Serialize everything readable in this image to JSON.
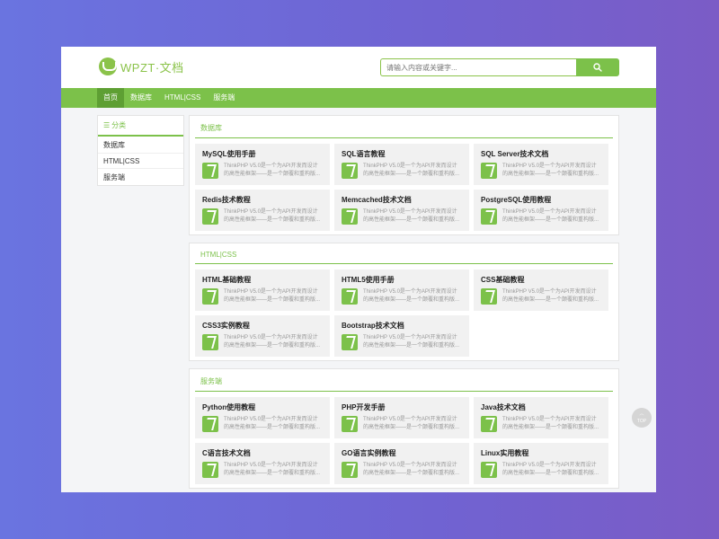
{
  "header": {
    "logo_text": "WPZT·文档",
    "search_placeholder": "请输入内容或关键字..."
  },
  "nav": {
    "items": [
      "首页",
      "数据库",
      "HTML|CSS",
      "服务端"
    ]
  },
  "sidebar": {
    "title": "分类",
    "items": [
      "数据库",
      "HTML|CSS",
      "服务端"
    ]
  },
  "sections": [
    {
      "title": "数据库",
      "cards": [
        {
          "title": "MySQL使用手册",
          "desc": "ThinkPHP V5.0是一个为API开发而设计的高性能框架——是一个颠覆和重构版..."
        },
        {
          "title": "SQL语言教程",
          "desc": "ThinkPHP V5.0是一个为API开发而设计的高性能框架——是一个颠覆和重构版..."
        },
        {
          "title": "SQL Server技术文档",
          "desc": "ThinkPHP V5.0是一个为API开发而设计的高性能框架——是一个颠覆和重构版..."
        },
        {
          "title": "Redis技术教程",
          "desc": "ThinkPHP V5.0是一个为API开发而设计的高性能框架——是一个颠覆和重构版..."
        },
        {
          "title": "Memcached技术文档",
          "desc": "ThinkPHP V5.0是一个为API开发而设计的高性能框架——是一个颠覆和重构版..."
        },
        {
          "title": "PostgreSQL使用教程",
          "desc": "ThinkPHP V5.0是一个为API开发而设计的高性能框架——是一个颠覆和重构版..."
        }
      ]
    },
    {
      "title": "HTML|CSS",
      "cards": [
        {
          "title": "HTML基础教程",
          "desc": "ThinkPHP V5.0是一个为API开发而设计的高性能框架——是一个颠覆和重构版..."
        },
        {
          "title": "HTML5使用手册",
          "desc": "ThinkPHP V5.0是一个为API开发而设计的高性能框架——是一个颠覆和重构版..."
        },
        {
          "title": "CSS基础教程",
          "desc": "ThinkPHP V5.0是一个为API开发而设计的高性能框架——是一个颠覆和重构版..."
        },
        {
          "title": "CSS3实例教程",
          "desc": "ThinkPHP V5.0是一个为API开发而设计的高性能框架——是一个颠覆和重构版..."
        },
        {
          "title": "Bootstrap技术文档",
          "desc": "ThinkPHP V5.0是一个为API开发而设计的高性能框架——是一个颠覆和重构版..."
        }
      ]
    },
    {
      "title": "服务端",
      "cards": [
        {
          "title": "Python使用教程",
          "desc": "ThinkPHP V5.0是一个为API开发而设计的高性能框架——是一个颠覆和重构版..."
        },
        {
          "title": "PHP开发手册",
          "desc": "ThinkPHP V5.0是一个为API开发而设计的高性能框架——是一个颠覆和重构版..."
        },
        {
          "title": "Java技术文档",
          "desc": "ThinkPHP V5.0是一个为API开发而设计的高性能框架——是一个颠覆和重构版..."
        },
        {
          "title": "C语言技术文档",
          "desc": "ThinkPHP V5.0是一个为API开发而设计的高性能框架——是一个颠覆和重构版..."
        },
        {
          "title": "GO语言实例教程",
          "desc": "ThinkPHP V5.0是一个为API开发而设计的高性能框架——是一个颠覆和重构版..."
        },
        {
          "title": "Linux实用教程",
          "desc": "ThinkPHP V5.0是一个为API开发而设计的高性能框架——是一个颠覆和重构版..."
        }
      ]
    }
  ],
  "top_button": {
    "label": "TOP",
    "icon": "chevron-up-icon"
  },
  "colors": {
    "accent": "#7cc14a",
    "nav_active": "#5e9f33"
  }
}
